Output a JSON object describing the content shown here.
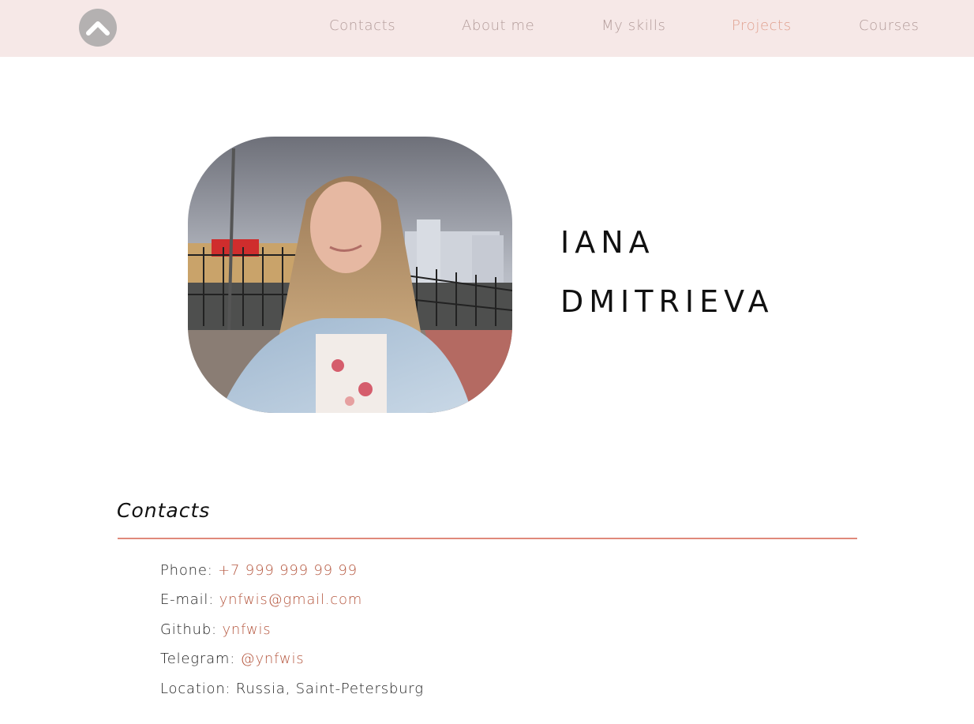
{
  "nav": {
    "logo_icon": "chevron-up-icon",
    "items": [
      {
        "label": "Contacts"
      },
      {
        "label": "About me"
      },
      {
        "label": "My skills"
      },
      {
        "label": "Projects"
      },
      {
        "label": "Courses"
      }
    ],
    "active_index": 3
  },
  "hero": {
    "first_name": "IANA",
    "last_name": "DMITRIEVA"
  },
  "contacts": {
    "title": "Contacts",
    "phone_label": "Phone: ",
    "phone_value": "+7 999 999 99 99",
    "email_label": "E-mail: ",
    "email_value": "ynfwis@gmail.com",
    "github_label": "Github: ",
    "github_value": "ynfwis",
    "telegram_label": "Telegram: ",
    "telegram_value": "@ynfwis",
    "location_label": "Location: ",
    "location_value": "Russia, Saint-Petersburg"
  },
  "colors": {
    "topbar_bg": "#f6e8e7",
    "nav_text": "#b39c9a",
    "nav_active": "#e0a08e",
    "accent": "#b5573f",
    "divider": "#e0897b"
  }
}
